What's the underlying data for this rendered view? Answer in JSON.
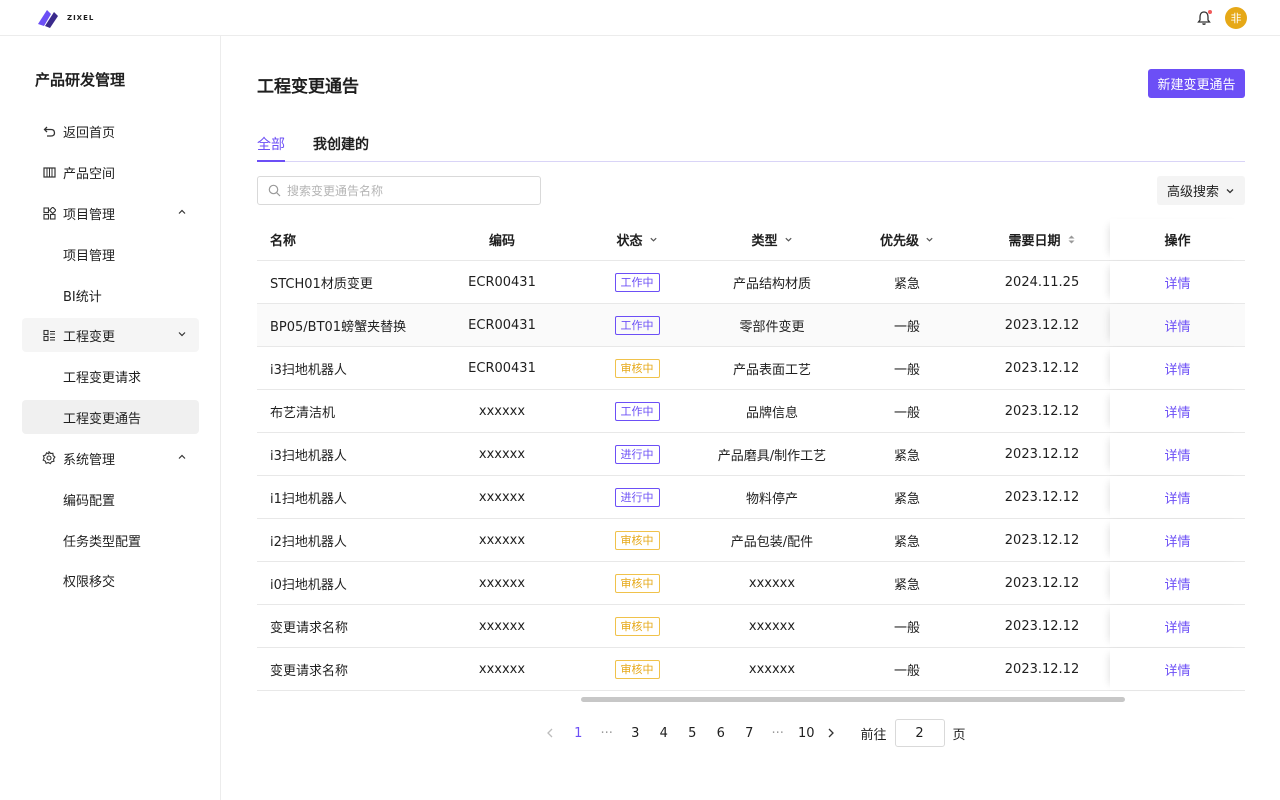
{
  "app": {
    "logo_text": "ZIXEL",
    "avatar_text": "非"
  },
  "sidebar": {
    "title": "产品研发管理",
    "items": [
      {
        "label": "返回首页"
      },
      {
        "label": "产品空间"
      },
      {
        "label": "项目管理"
      },
      {
        "label": "项目管理"
      },
      {
        "label": "BI统计"
      },
      {
        "label": "工程变更"
      },
      {
        "label": "工程变更请求"
      },
      {
        "label": "工程变更通告"
      },
      {
        "label": "系统管理"
      },
      {
        "label": "编码配置"
      },
      {
        "label": "任务类型配置"
      },
      {
        "label": "权限移交"
      }
    ]
  },
  "main": {
    "title": "工程变更通告",
    "new_button": "新建变更通告",
    "tabs": [
      {
        "label": "全部"
      },
      {
        "label": "我创建的"
      }
    ],
    "search": {
      "placeholder": "搜索变更通告名称"
    },
    "advanced_search": "高级搜索",
    "columns": [
      "名称",
      "编码",
      "状态",
      "类型",
      "优先级",
      "需要日期",
      "操作"
    ],
    "rows": [
      {
        "name": "STCH01材质变更",
        "code": "ECR00431",
        "status": "工作中",
        "status_color": "purple",
        "type": "产品结构材质",
        "priority": "紧急",
        "date": "2024.11.25",
        "action": "详情"
      },
      {
        "name": "BP05/BT01螃蟹夹替换",
        "code": "ECR00431",
        "status": "工作中",
        "status_color": "purple",
        "type": "零部件变更",
        "priority": "一般",
        "date": "2023.12.12",
        "action": "详情"
      },
      {
        "name": "i3扫地机器人",
        "code": "ECR00431",
        "status": "审核中",
        "status_color": "orange",
        "type": "产品表面工艺",
        "priority": "一般",
        "date": "2023.12.12",
        "action": "详情"
      },
      {
        "name": "布艺清洁机",
        "code": "xxxxxx",
        "status": "工作中",
        "status_color": "purple",
        "type": "品牌信息",
        "priority": "一般",
        "date": "2023.12.12",
        "action": "详情"
      },
      {
        "name": "i3扫地机器人",
        "code": "xxxxxx",
        "status": "进行中",
        "status_color": "purple",
        "type": "产品磨具/制作工艺",
        "priority": "紧急",
        "date": "2023.12.12",
        "action": "详情"
      },
      {
        "name": "i1扫地机器人",
        "code": "xxxxxx",
        "status": "进行中",
        "status_color": "purple",
        "type": "物料停产",
        "priority": "紧急",
        "date": "2023.12.12",
        "action": "详情"
      },
      {
        "name": "i2扫地机器人",
        "code": "xxxxxx",
        "status": "审核中",
        "status_color": "orange",
        "type": "产品包装/配件",
        "priority": "紧急",
        "date": "2023.12.12",
        "action": "详情"
      },
      {
        "name": "i0扫地机器人",
        "code": "xxxxxx",
        "status": "审核中",
        "status_color": "orange",
        "type": "xxxxxx",
        "priority": "紧急",
        "date": "2023.12.12",
        "action": "详情"
      },
      {
        "name": "变更请求名称",
        "code": "xxxxxx",
        "status": "审核中",
        "status_color": "orange",
        "type": "xxxxxx",
        "priority": "一般",
        "date": "2023.12.12",
        "action": "详情"
      },
      {
        "name": "变更请求名称",
        "code": "xxxxxx",
        "status": "审核中",
        "status_color": "orange",
        "type": "xxxxxx",
        "priority": "一般",
        "date": "2023.12.12",
        "action": "详情"
      }
    ]
  },
  "pagination": {
    "pages": [
      "1",
      "···",
      "3",
      "4",
      "5",
      "6",
      "7",
      "···",
      "10"
    ],
    "current": "1",
    "goto_label": "前往",
    "goto_value": "2",
    "goto_unit": "页"
  },
  "colors": {
    "accent": "#6c4ff6",
    "warning": "#e6a817",
    "avatar": "#e6a817"
  }
}
